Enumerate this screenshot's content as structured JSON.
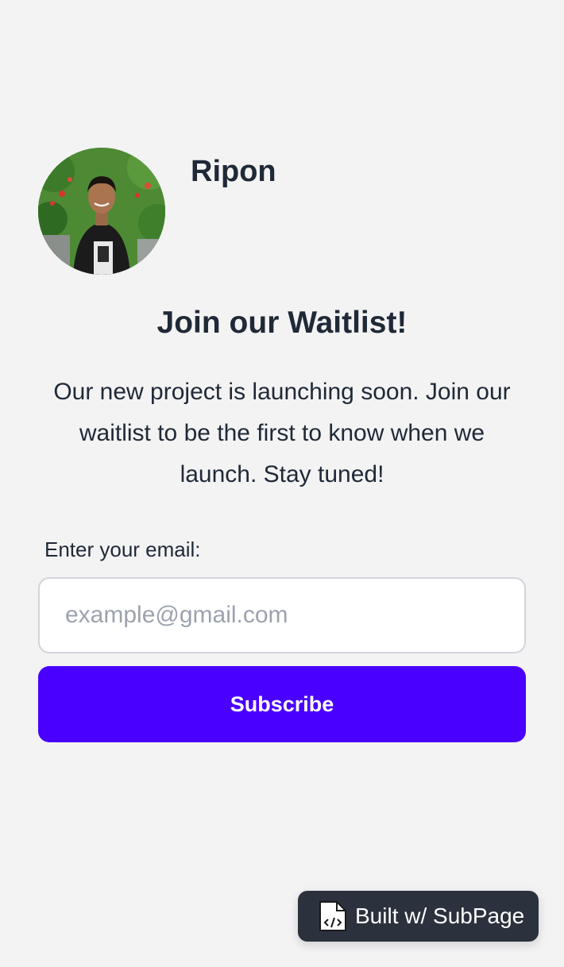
{
  "profile": {
    "name": "Ripon",
    "avatar_icon": "user-photo"
  },
  "headline": "Join our Waitlist!",
  "description": "Our new project is launching soon. Join our waitlist to be the first to know when we launch. Stay tuned!",
  "form": {
    "email_label": "Enter your email:",
    "email_placeholder": "example@gmail.com",
    "email_value": "",
    "subscribe_label": "Subscribe"
  },
  "badge": {
    "text": "Built w/ SubPage",
    "icon": "code-file-icon"
  },
  "colors": {
    "background": "#f3f3f4",
    "accent": "#4a00ff",
    "text": "#1f2937",
    "badge_bg": "#2b313d"
  }
}
